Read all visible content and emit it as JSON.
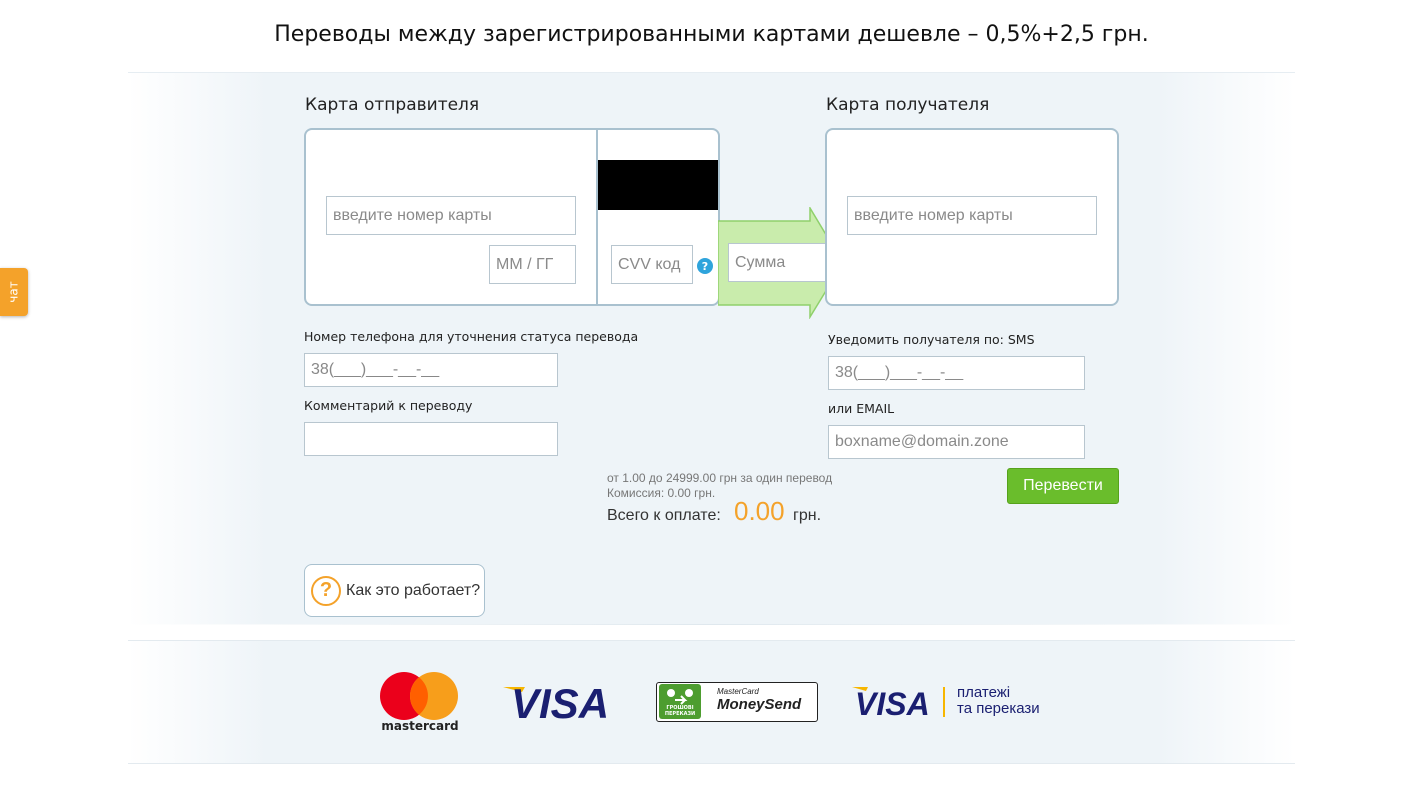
{
  "headline": "Переводы между зарегистрированными картами дешевле – 0,5%+2,5 грн.",
  "chat_tab": "чат",
  "sender": {
    "title": "Карта отправителя",
    "card_number_placeholder": "введите номер карты",
    "expiry_placeholder": "ММ / ГГ",
    "cvv_placeholder": "CVV код",
    "cvv_help": "?"
  },
  "amount_placeholder": "Сумма",
  "recipient": {
    "title": "Карта получателя",
    "card_number_placeholder": "введите номер карты"
  },
  "phone": {
    "label": "Номер телефона для уточнения статуса перевода",
    "value": "38(___)___-__-__"
  },
  "comment": {
    "label": "Комментарий к переводу",
    "value": ""
  },
  "notify": {
    "sms_label": "Уведомить получателя по: SMS",
    "sms_value": "38(___)___-__-__",
    "email_label": "или EMAIL",
    "email_placeholder": "boxname@domain.zone"
  },
  "limits": {
    "range_text": "от 1.00 до 24999.00 грн за один перевод",
    "commission_text": "Комиссия: 0.00 грн."
  },
  "total": {
    "label": "Всего к оплате:",
    "amount": "0.00",
    "currency": "грн."
  },
  "submit_label": "Перевести",
  "how_it_works": {
    "icon": "?",
    "label": "Как это работает?"
  },
  "logos": {
    "mastercard": "mastercard",
    "visa": "VISA",
    "moneysend_brand": "MasterCard",
    "moneysend_name": "MoneySend",
    "moneysend_badge": "ГРОШОВІ ПЕРЕКАЗИ",
    "visa2": "VISA",
    "visa2_text_line1": "платежі",
    "visa2_text_line2": "та перекази"
  },
  "colors": {
    "accent_green": "#6abd2c",
    "total_orange": "#f4a22a",
    "chat_orange": "#f4a22a",
    "card_border": "#a9c1cf",
    "arrow_fill": "#c9ecac"
  }
}
